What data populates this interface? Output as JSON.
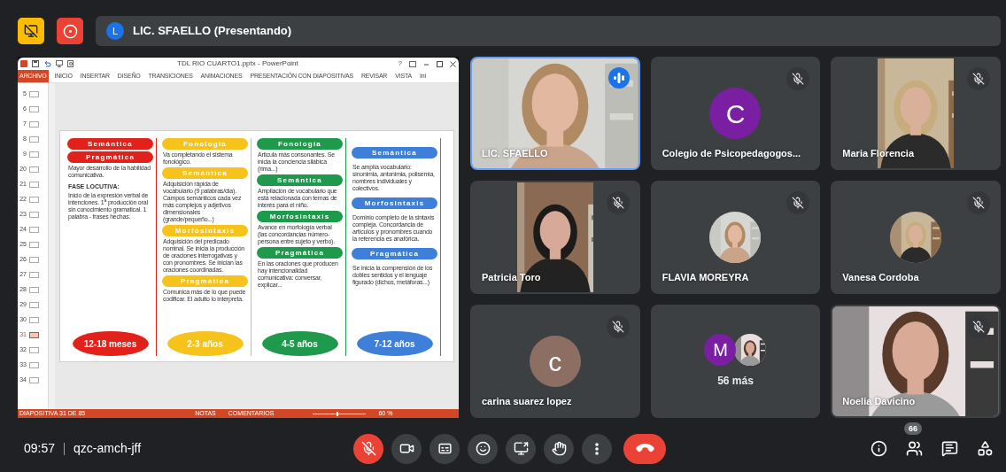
{
  "top_bar": {
    "presenter_initial": "L",
    "presenter_label": "LIC. SFAELLO (Presentando)"
  },
  "shared_screen": {
    "window_title": "TDL RIO CUARTO1.pptx - PowerPoint",
    "help": "?",
    "ribbon_tabs": [
      {
        "label": "ARCHIVO",
        "selected": true
      },
      {
        "label": "INICIO",
        "selected": false
      },
      {
        "label": "INSERTAR",
        "selected": false
      },
      {
        "label": "DISEÑO",
        "selected": false
      },
      {
        "label": "TRANSICIONES",
        "selected": false
      },
      {
        "label": "ANIMACIONES",
        "selected": false
      },
      {
        "label": "PRESENTACIÓN CON DIAPOSITIVAS",
        "selected": false
      },
      {
        "label": "REVISAR",
        "selected": false
      },
      {
        "label": "VISTA",
        "selected": false
      },
      {
        "label": "Ini",
        "selected": false
      }
    ],
    "thumbnails": [
      {
        "number": "5",
        "selected": false
      },
      {
        "number": "6",
        "selected": false
      },
      {
        "number": "7",
        "selected": false
      },
      {
        "number": "8",
        "selected": false
      },
      {
        "number": "9",
        "selected": false
      },
      {
        "number": "20",
        "selected": false
      },
      {
        "number": "21",
        "selected": false
      },
      {
        "number": "22",
        "selected": false
      },
      {
        "number": "23",
        "selected": false
      },
      {
        "number": "24",
        "selected": false
      },
      {
        "number": "25",
        "selected": false
      },
      {
        "number": "26",
        "selected": false
      },
      {
        "number": "27",
        "selected": false
      },
      {
        "number": "28",
        "selected": false
      },
      {
        "number": "29",
        "selected": false
      },
      {
        "number": "30",
        "selected": false
      },
      {
        "number": "31",
        "selected": true
      },
      {
        "number": "32",
        "selected": false
      },
      {
        "number": "33",
        "selected": false
      },
      {
        "number": "34",
        "selected": false
      }
    ],
    "slide": {
      "columns": [
        {
          "color": "#e3211b",
          "blocks": [
            {
              "kind": "heading",
              "text": "Semántica"
            },
            {
              "kind": "heading",
              "text": "Pragmática"
            },
            {
              "kind": "text",
              "text": "Mayor desarrollo de la habilidad comunicativa."
            },
            {
              "kind": "subheading",
              "text": "FASE LOCUTIVA:"
            },
            {
              "kind": "text",
              "text": "Inicio de la expresión verbal de intenciones. 1$^{a}$ producción oral sin conocimiento gramatical. 1 palabra - frases hechas."
            }
          ],
          "age": "12-18 meses"
        },
        {
          "color": "#f6c21c",
          "blocks": [
            {
              "kind": "heading",
              "text": "Fonología"
            },
            {
              "kind": "text",
              "text": "Va completando el sistema fonológico."
            },
            {
              "kind": "heading",
              "text": "Semántica"
            },
            {
              "kind": "text",
              "text": "Adquisición rápida de vocabulario (9 palabras/día). Campos semánticos cada vez más complejos y adjetivos dimensionales (grande/pequeño...)"
            },
            {
              "kind": "heading",
              "text": "Morfosintaxis"
            },
            {
              "kind": "text",
              "text": "Adquisición del predicado nominal. Se inicia la producción de oraciones interrogativas y con pronombres. Se inician las oraciones coordinadas."
            },
            {
              "kind": "heading",
              "text": "Pragmática"
            },
            {
              "kind": "text",
              "text": "Comunica más de lo que puede codificar. El adulto lo interpreta."
            }
          ],
          "age": "2-3 años"
        },
        {
          "color": "#1f9a4c",
          "blocks": [
            {
              "kind": "heading",
              "text": "Fonología"
            },
            {
              "kind": "text",
              "text": "Articula más consonantes. Se inicia la conciencia silábica (rima...)"
            },
            {
              "kind": "heading",
              "text": "Semántica"
            },
            {
              "kind": "text",
              "text": "Ampliación de vocabulario que está relacionada con temas de interés para el niño."
            },
            {
              "kind": "heading",
              "text": "Morfosintaxis"
            },
            {
              "kind": "text",
              "text": "Avance en morfología verbal (las concordancias número-persona entre sujeto y verbo)."
            },
            {
              "kind": "heading",
              "text": "Pragmática"
            },
            {
              "kind": "text",
              "text": "En las oraciones que producen hay intencionalidad comunicativa: conversar, explicar..."
            }
          ],
          "age": "4-5 años"
        },
        {
          "color": "#3d7fd9",
          "blocks": [
            {
              "kind": "heading",
              "text": "Semántica"
            },
            {
              "kind": "text",
              "text": "Se amplía vocabulario: sinonimia, antonimia, polisemia, nombres individuales y colectivos."
            },
            {
              "kind": "heading",
              "text": "Morfosintaxis"
            },
            {
              "kind": "text",
              "text": "Dominio completo de la sintaxis compleja. Concordancia de artículos y pronombres cuando la referencia es anafórica."
            },
            {
              "kind": "heading",
              "text": "Pragmática"
            },
            {
              "kind": "text",
              "text": "Se inicia la comprensión de los dobles sentidos y el lenguaje figurado (dichos, metáforas...)"
            }
          ],
          "age": "7-12 años"
        }
      ]
    },
    "status_bar": {
      "slide_counter": "DIAPOSITIVA 31 DE 85",
      "notes": "NOTAS",
      "comments": "COMENTARIOS",
      "zoom": "60 %",
      "zoom_slider": {
        "level": 0.45
      }
    }
  },
  "tiles": [
    {
      "kind": "video",
      "name": "LIC. SFAELLO",
      "muted": false,
      "speaking": true
    },
    {
      "kind": "avatar",
      "name": "Colegio de Psicopedagogos...",
      "initial": "C",
      "color": "#7b1fa2",
      "muted": true,
      "speaking": false
    },
    {
      "kind": "portrait_video",
      "name": "Maria Florencia",
      "muted": true,
      "speaking": false
    },
    {
      "kind": "portrait_video",
      "name": "Patricia Toro",
      "muted": true,
      "speaking": false
    },
    {
      "kind": "photo_avatar",
      "name": "FLAVIA MOREYRA",
      "muted": true,
      "speaking": false
    },
    {
      "kind": "photo_avatar",
      "name": "Vanesa Cordoba",
      "muted": true,
      "speaking": false
    },
    {
      "kind": "avatar",
      "name": "carina suarez lopez",
      "initial": "c",
      "color": "#8d6e63",
      "muted": true,
      "speaking": false
    },
    {
      "kind": "overflow",
      "initial": "M",
      "color": "#7b1fa2",
      "label": "56 más"
    },
    {
      "kind": "video",
      "name": "Noelia Davicino",
      "muted": true,
      "speaking": false
    }
  ],
  "bottom_bar": {
    "time": "09:57",
    "meeting_code": "qzc-amch-jff",
    "controls": [
      {
        "kind": "mic",
        "on": false
      },
      {
        "kind": "camera",
        "on": true
      },
      {
        "kind": "captions"
      },
      {
        "kind": "emoji"
      },
      {
        "kind": "present"
      },
      {
        "kind": "hand"
      },
      {
        "kind": "more"
      },
      {
        "kind": "end_call"
      }
    ],
    "side": [
      {
        "kind": "info"
      },
      {
        "kind": "people",
        "badge": "66"
      },
      {
        "kind": "chat"
      },
      {
        "kind": "activities"
      }
    ]
  }
}
